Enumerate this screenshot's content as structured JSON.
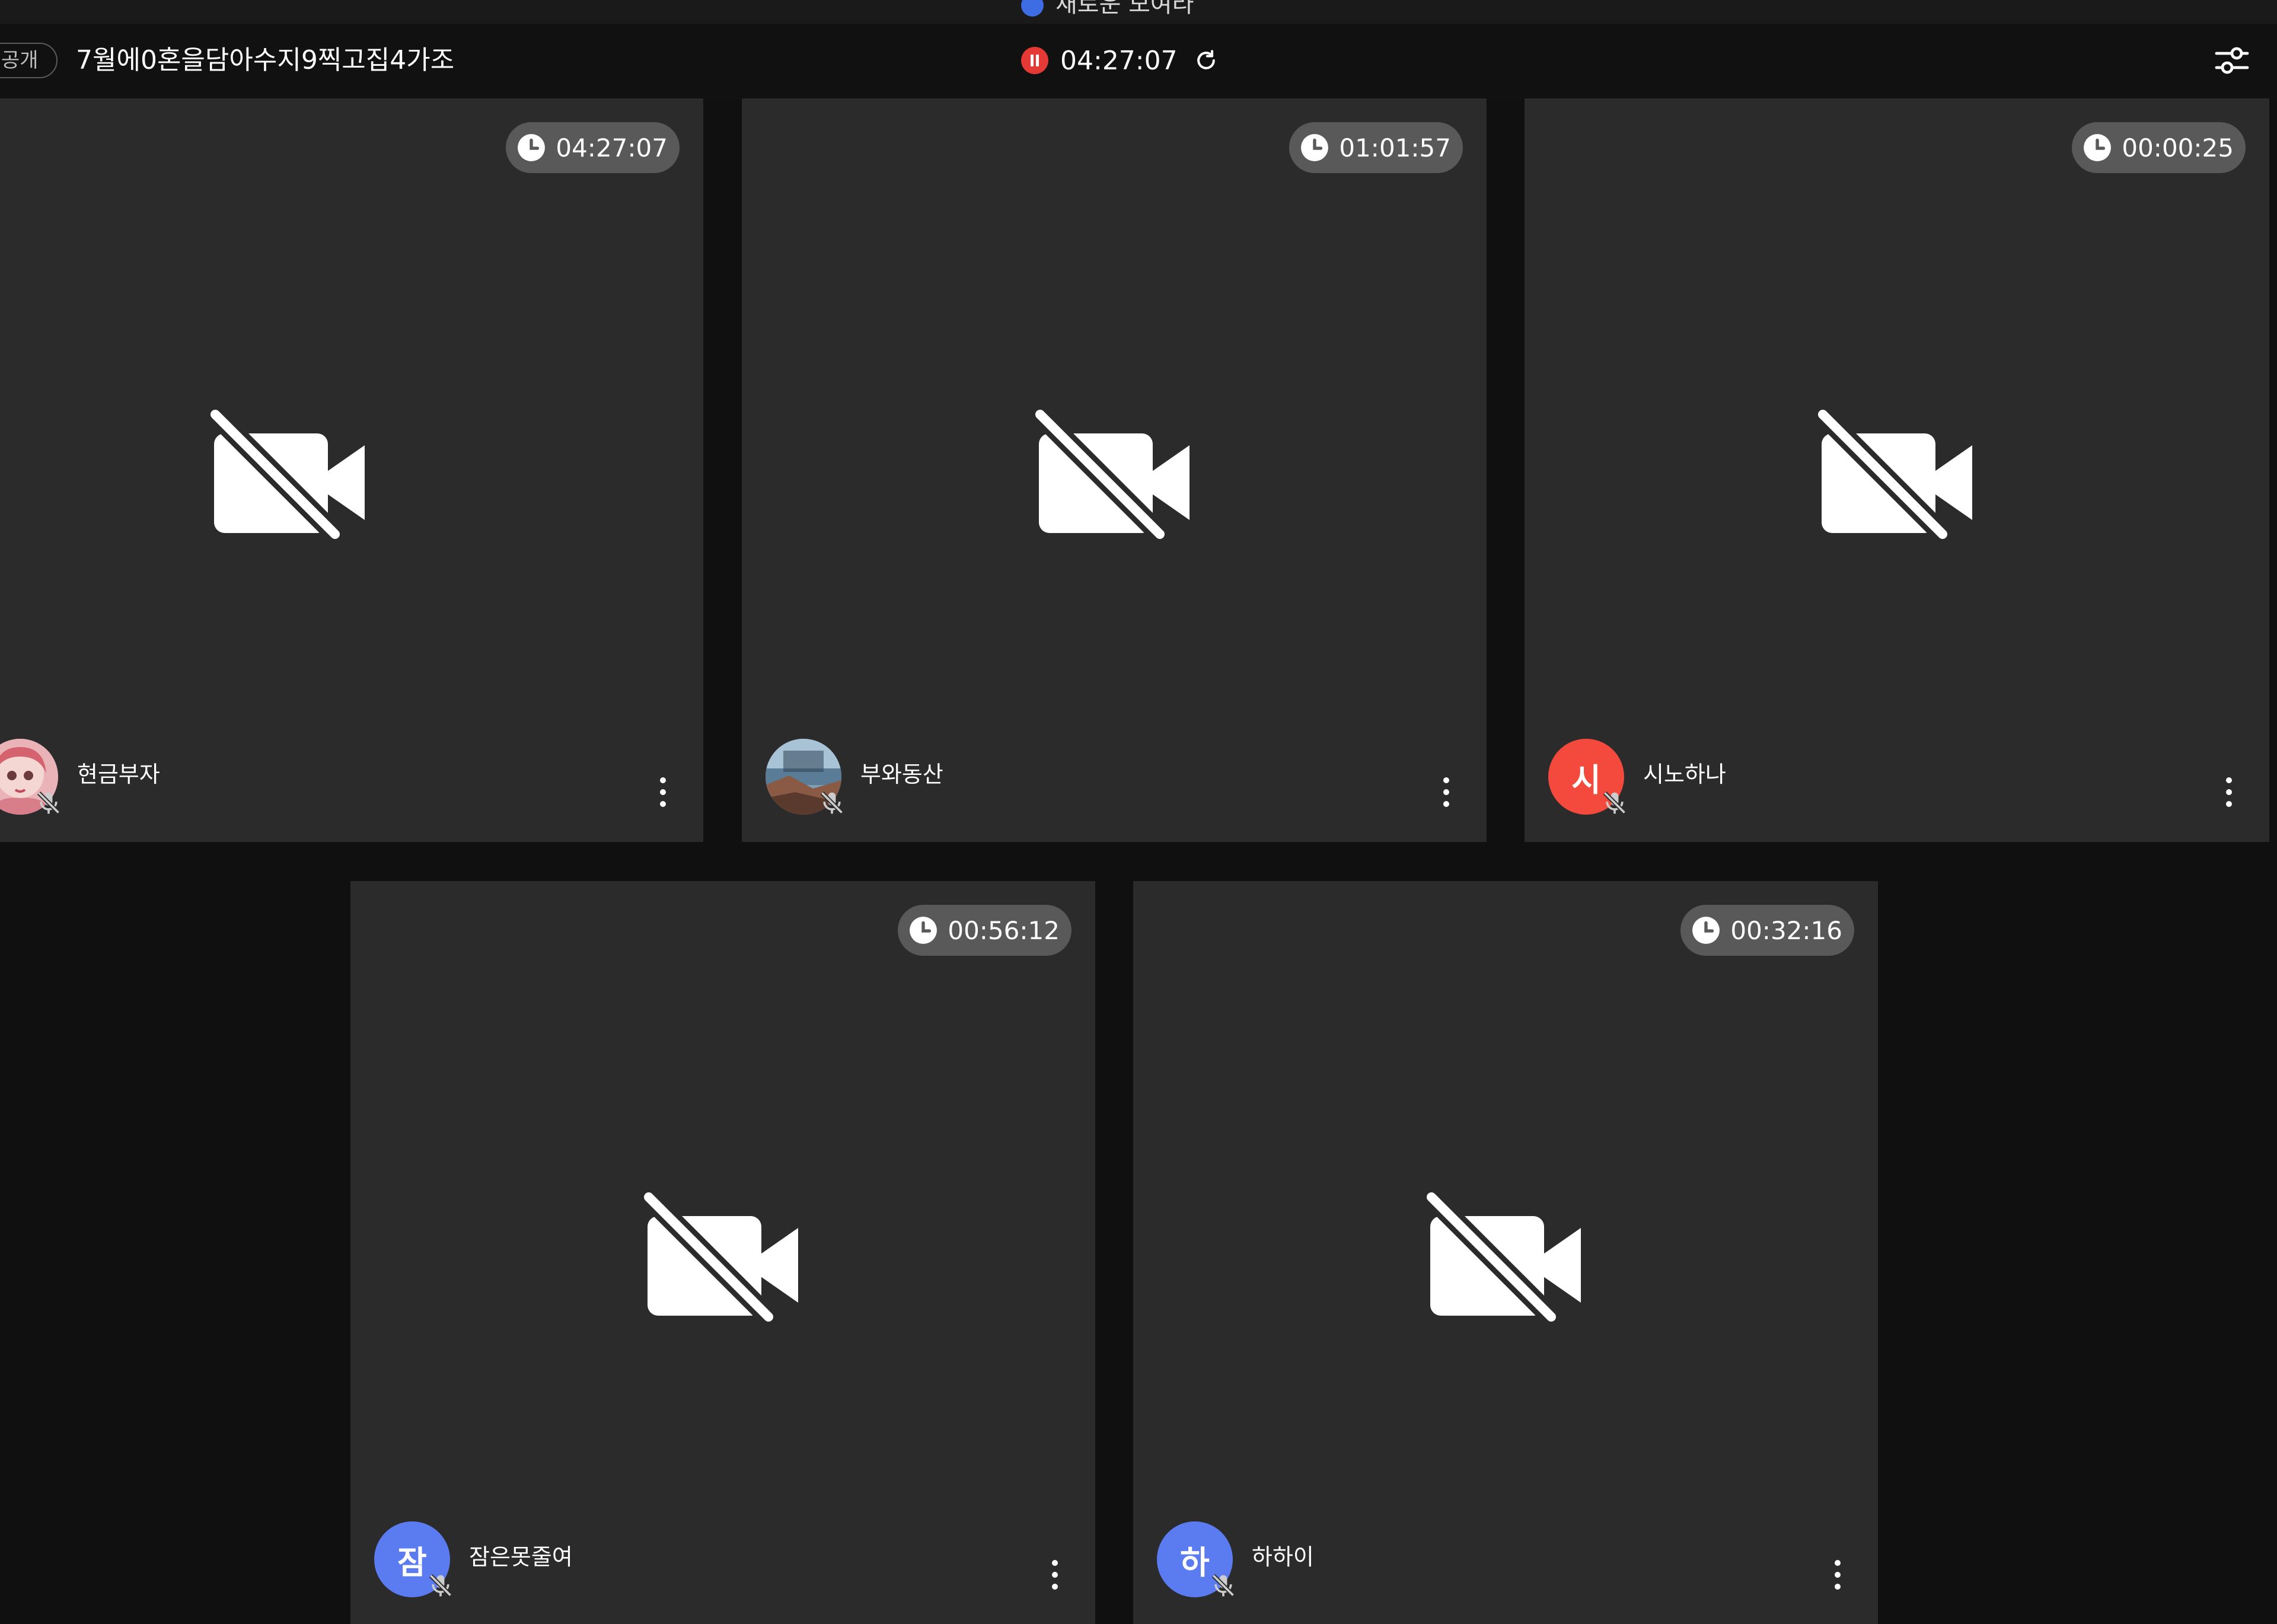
{
  "top_strip": {
    "text": "새로운 모여라"
  },
  "header": {
    "visibility_badge": "공개",
    "room_title": "7월에0혼을담아수지9찍고집4가조",
    "recording_time": "04:27:07",
    "recording_color": "#e53935"
  },
  "tiles": [
    {
      "name": "현금부자",
      "timer": "04:27:07",
      "avatar_type": "photo-doll",
      "avatar_letter": "",
      "avatar_color": "#e6a0a8"
    },
    {
      "name": "부와동산",
      "timer": "01:01:57",
      "avatar_type": "photo-landscape",
      "avatar_letter": "",
      "avatar_color": "#6f8fa8"
    },
    {
      "name": "시노하나",
      "timer": "00:00:25",
      "avatar_type": "letter",
      "avatar_letter": "시",
      "avatar_color": "#f44a3e"
    },
    {
      "name": "잠은못줄여",
      "timer": "00:56:12",
      "avatar_type": "letter",
      "avatar_letter": "잠",
      "avatar_color": "#5b7cf0"
    },
    {
      "name": "하하이",
      "timer": "00:32:16",
      "avatar_type": "letter",
      "avatar_letter": "하",
      "avatar_color": "#5b7cf0"
    }
  ],
  "colors": {
    "background": "#101010",
    "tile_background": "#2b2b2b",
    "timer_pill": "#595959"
  },
  "icons": {
    "camera_off": "video-off-icon",
    "clock": "clock-icon",
    "mic_muted": "mic-off-icon",
    "more": "more-vertical-icon",
    "settings": "sliders-icon",
    "refresh": "refresh-icon"
  }
}
